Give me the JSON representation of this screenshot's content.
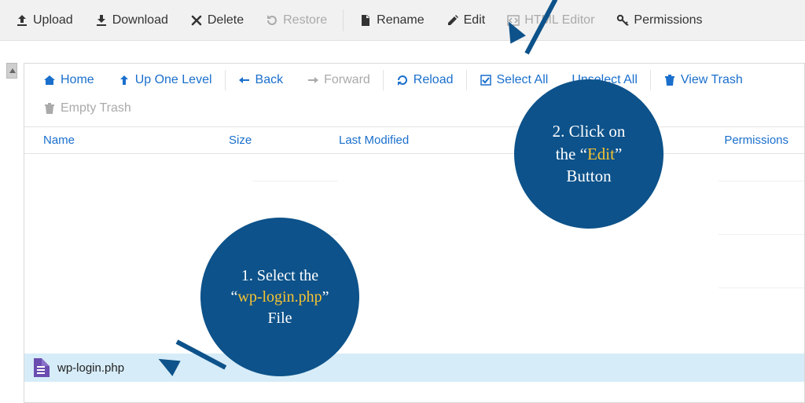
{
  "toolbar": {
    "upload": "Upload",
    "download": "Download",
    "delete": "Delete",
    "restore": "Restore",
    "rename": "Rename",
    "edit": "Edit",
    "html_editor": "HTML Editor",
    "permissions": "Permissions"
  },
  "nav": {
    "home": "Home",
    "up_one": "Up One Level",
    "back": "Back",
    "forward": "Forward",
    "reload": "Reload",
    "select_all": "Select All",
    "unselect_all": "Unselect All",
    "view_trash": "View Trash",
    "empty_trash": "Empty Trash"
  },
  "columns": {
    "name": "Name",
    "size": "Size",
    "last_modified": "Last Modified",
    "permissions": "Permissions"
  },
  "file": {
    "name": "wp-login.php"
  },
  "annotations": {
    "one_pre": "1. Select the",
    "one_q1": "“",
    "one_hl": "wp-login.php",
    "one_q2": "”",
    "one_post": "File",
    "two_pre": "2. Click on",
    "two_mid1": "the “",
    "two_hl": "Edit",
    "two_mid2": "”",
    "two_post": "Button"
  }
}
